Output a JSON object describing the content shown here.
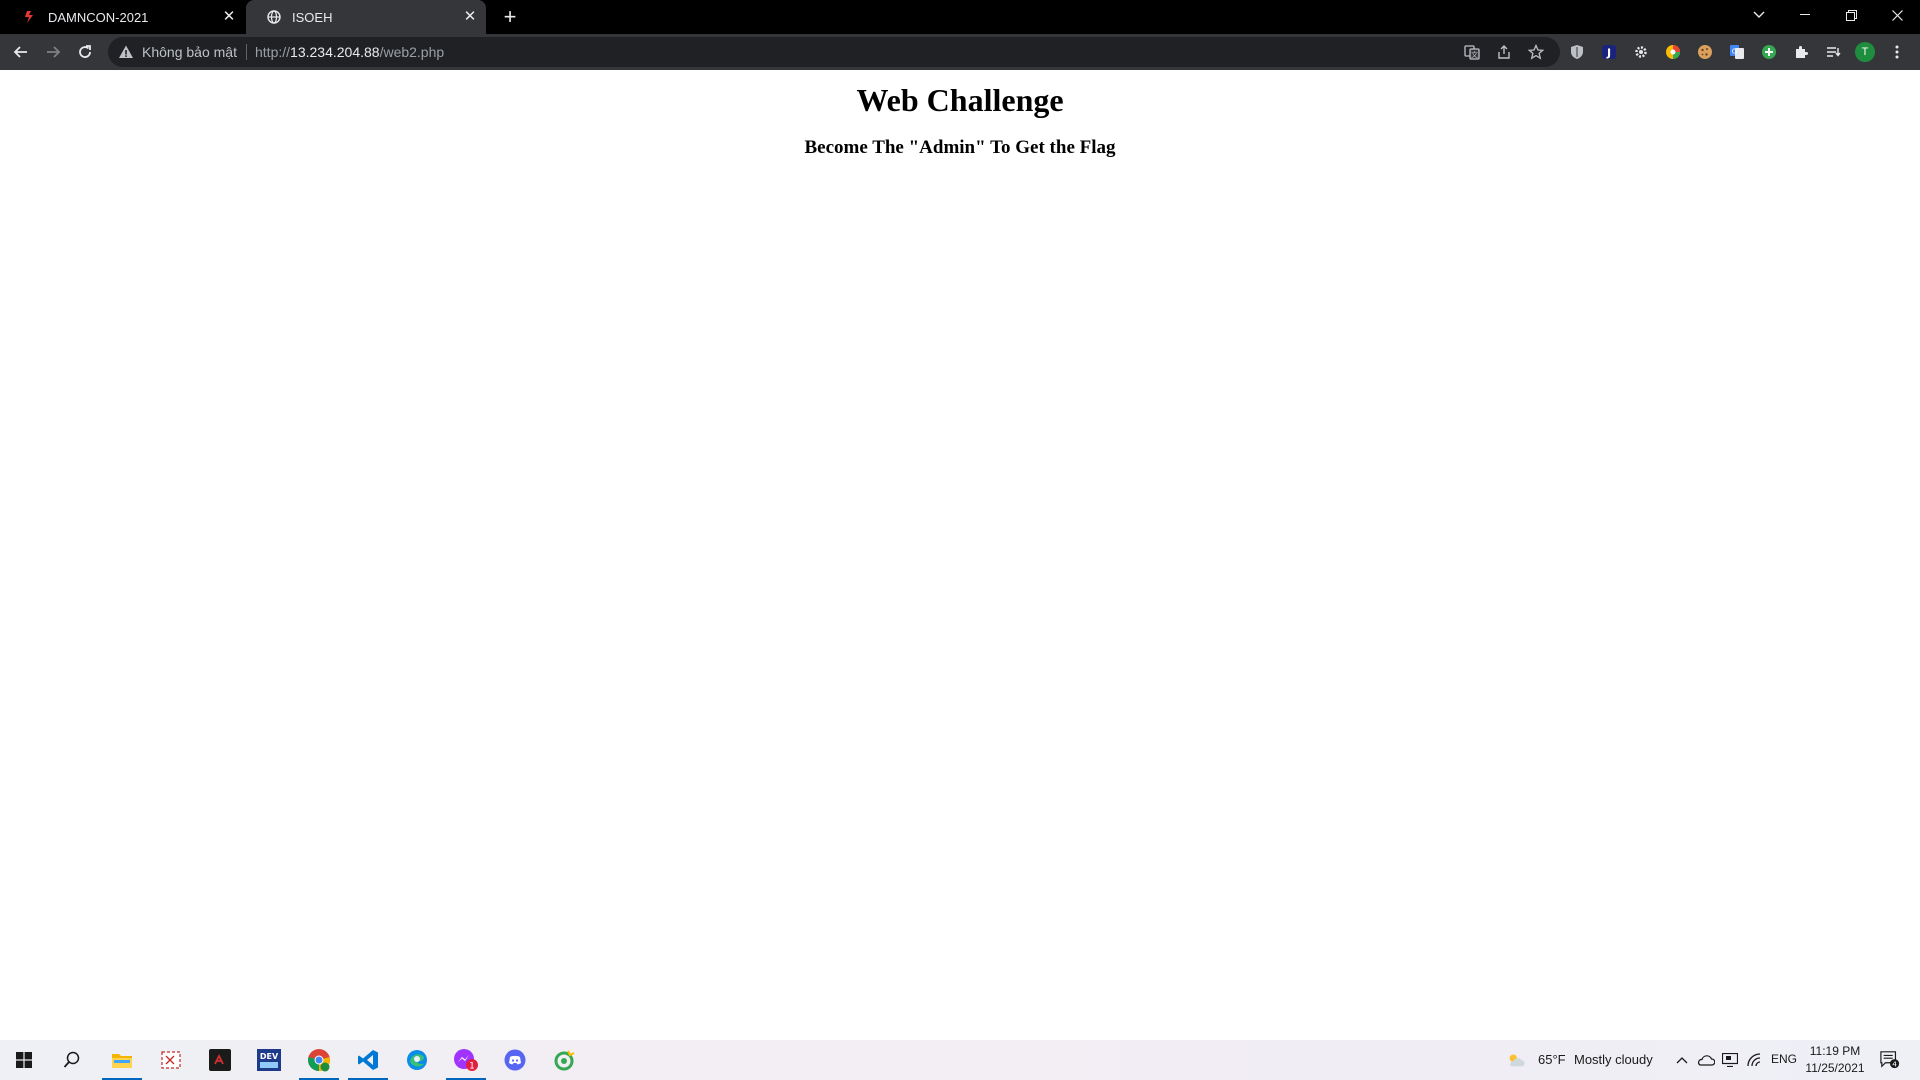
{
  "browser": {
    "tabs": [
      {
        "title": "DAMNCON-2021",
        "active": false
      },
      {
        "title": "ISOEH",
        "active": true
      }
    ],
    "address": {
      "security_label": "Không bảo mật",
      "url_scheme": "http://",
      "url_host": "13.234.204.88",
      "url_path": "/web2.php"
    },
    "profile_initial": "T"
  },
  "page": {
    "heading": "Web Challenge",
    "subheading": "Become The \"Admin\" To Get the Flag"
  },
  "taskbar": {
    "weather_temp": "65°F",
    "weather_desc": "Mostly cloudy",
    "language": "ENG",
    "time": "11:19 PM",
    "date": "11/25/2021",
    "notification_count": "4",
    "messenger_badge": "1"
  },
  "colors": {
    "titlebar": "#000000",
    "toolbar": "#35363a",
    "omnibox": "#202124",
    "accent": "#0067c0"
  }
}
